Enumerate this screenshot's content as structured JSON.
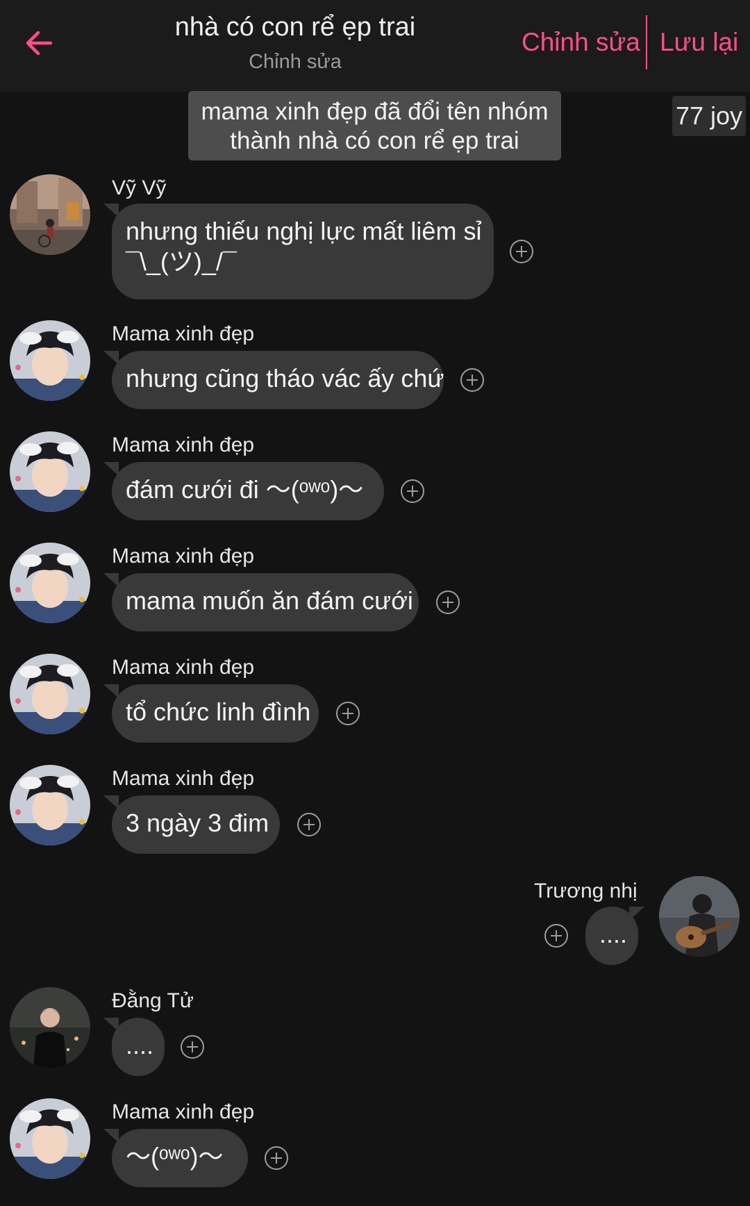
{
  "header": {
    "title": "nhà có con rể ẹp trai",
    "subtitle": "Chỉnh sửa",
    "edit_label": "Chỉnh sửa",
    "save_label": "Lưu lại",
    "accent_color": "#ff4f8a"
  },
  "system_message": {
    "line1": "mama xinh đẹp đã đổi tên nhóm",
    "line2": "thành nhà có con rể ẹp trai"
  },
  "badge": "77 joy",
  "messages": [
    {
      "sender": "Vỹ Vỹ",
      "lines": [
        "nhưng thiếu nghị lực mất liêm sỉ",
        "¯\\_(ツ)_/¯"
      ]
    },
    {
      "sender": "Mama xinh đẹp",
      "text": "nhưng cũng tháo vác ấy chứ"
    },
    {
      "sender": "Mama xinh đẹp",
      "text": "đám cưới đi ～(ᵒʷᵒ)～"
    },
    {
      "sender": "Mama xinh đẹp",
      "text": "mama muốn ăn đám cưới"
    },
    {
      "sender": "Mama xinh đẹp",
      "text": "tổ chức linh đình"
    },
    {
      "sender": "Mama xinh đẹp",
      "text": "3 ngày 3 đim"
    },
    {
      "sender": "Trương nhị",
      "text": "...."
    },
    {
      "sender": "Đằng Tử",
      "text": "...."
    },
    {
      "sender": "Mama xinh đẹp",
      "text": "～(ᵒʷᵒ)～"
    }
  ],
  "icons": {
    "back": "arrow-left-icon",
    "react": "plus-circle-icon"
  }
}
